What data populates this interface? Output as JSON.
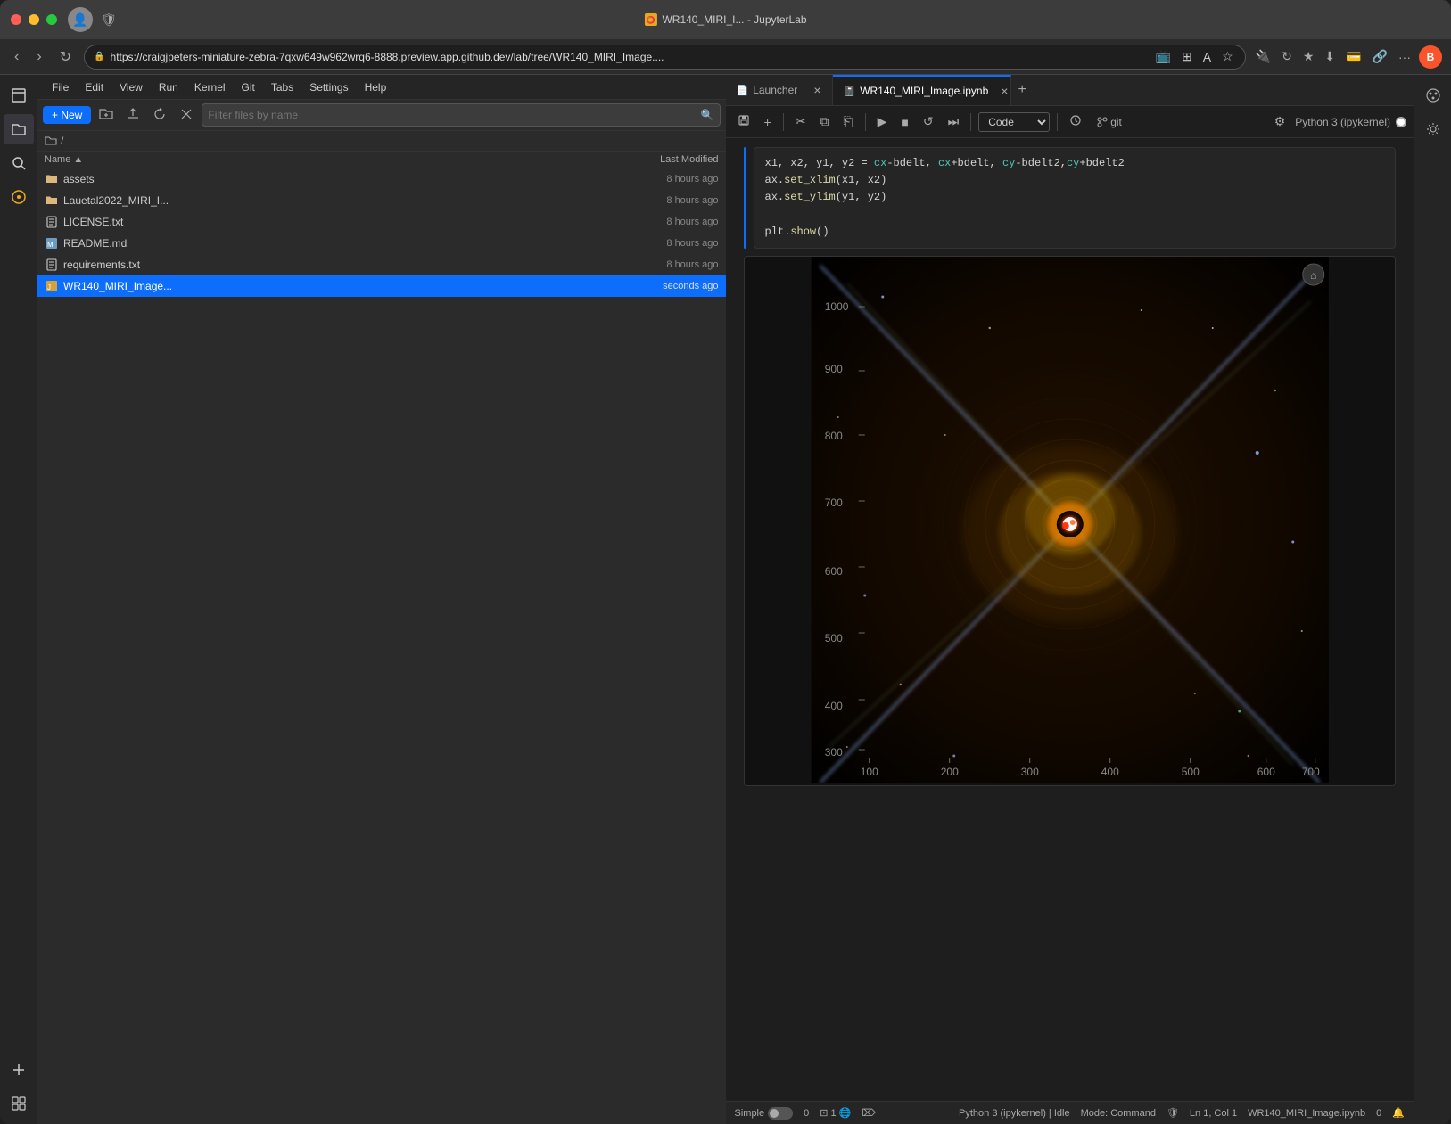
{
  "browser": {
    "title": "WR140_MIRI_I... - JupyterLab",
    "url_full": "https://craigjpeters-miniature-zebra-7qxw649w962wrq6-8888.preview.app.github.dev/lab/tree/WR140_MIRI_Image....",
    "url_display": "craigjpeters-miniature-zebra-7qxw649w962wrq6-8888.preview.app.github.dev",
    "url_path": "/lab/tree/WR140_MIRI_Image...."
  },
  "menu": {
    "items": [
      "File",
      "Edit",
      "View",
      "Run",
      "Kernel",
      "Git",
      "Tabs",
      "Settings",
      "Help"
    ]
  },
  "tabs": [
    {
      "id": "launcher",
      "label": "Launcher",
      "icon": "📄",
      "active": false,
      "dirty": false
    },
    {
      "id": "notebook",
      "label": "WR140_MIRI_Image.ipynb",
      "icon": "📓",
      "active": true,
      "dirty": true
    }
  ],
  "file_panel": {
    "search_placeholder": "Filter files by name",
    "breadcrumb": "/",
    "columns": {
      "name": "Name",
      "modified": "Last Modified"
    },
    "files": [
      {
        "name": "assets",
        "type": "folder",
        "modified": "8 hours ago"
      },
      {
        "name": "Lauetal2022_MIRI_I...",
        "type": "folder",
        "modified": "8 hours ago"
      },
      {
        "name": "LICENSE.txt",
        "type": "file",
        "modified": "8 hours ago"
      },
      {
        "name": "README.md",
        "type": "md",
        "modified": "8 hours ago"
      },
      {
        "name": "requirements.txt",
        "type": "file",
        "modified": "8 hours ago"
      },
      {
        "name": "WR140_MIRI_Image...",
        "type": "notebook",
        "modified": "seconds ago",
        "selected": true
      }
    ]
  },
  "notebook": {
    "toolbar": {
      "save": "💾",
      "add_cell": "+",
      "cut": "✂",
      "copy": "⎘",
      "paste": "⎗",
      "run": "▶",
      "stop": "■",
      "restart": "↺",
      "fast_forward": "⏭",
      "cell_type": "Code",
      "schedule": "🕐",
      "git": "git",
      "kernel_name": "Python 3 (ipykernel)",
      "settings": "⚙"
    },
    "code": [
      "x1, x2, y1, y2 = cx-bdelt, cx+bdelt, cy-bdelt2,cy+bdelt2",
      "ax.set_xlim(x1, x2)",
      "ax.set_ylim(y1, y2)",
      "",
      "plt.show()"
    ]
  },
  "sidebar_icons": [
    {
      "id": "files",
      "symbol": "📁",
      "active": true
    },
    {
      "id": "search",
      "symbol": "🔍",
      "active": false
    },
    {
      "id": "git",
      "symbol": "⭕",
      "active": false,
      "orange": true
    },
    {
      "id": "new",
      "symbol": "➕",
      "active": false
    },
    {
      "id": "extensions",
      "symbol": "🔌",
      "active": false
    }
  ],
  "right_sidebar_icons": [
    {
      "id": "palette",
      "symbol": "🎨"
    },
    {
      "id": "extensions2",
      "symbol": "🔧"
    }
  ],
  "status_bar": {
    "mode": "Simple",
    "errors": "0",
    "python": "Python 3 (ipykernel) | Idle",
    "command_mode": "Mode: Command",
    "position": "Ln 1, Col 1",
    "kernel": "WR140_MIRI_Image.ipynb",
    "notifications": "0"
  },
  "colors": {
    "accent_blue": "#0d6efd",
    "selected_blue": "#1565c0",
    "orange": "#e8a822",
    "bg_dark": "#1e1e1e",
    "bg_sidebar": "#252526",
    "border": "#333333"
  }
}
